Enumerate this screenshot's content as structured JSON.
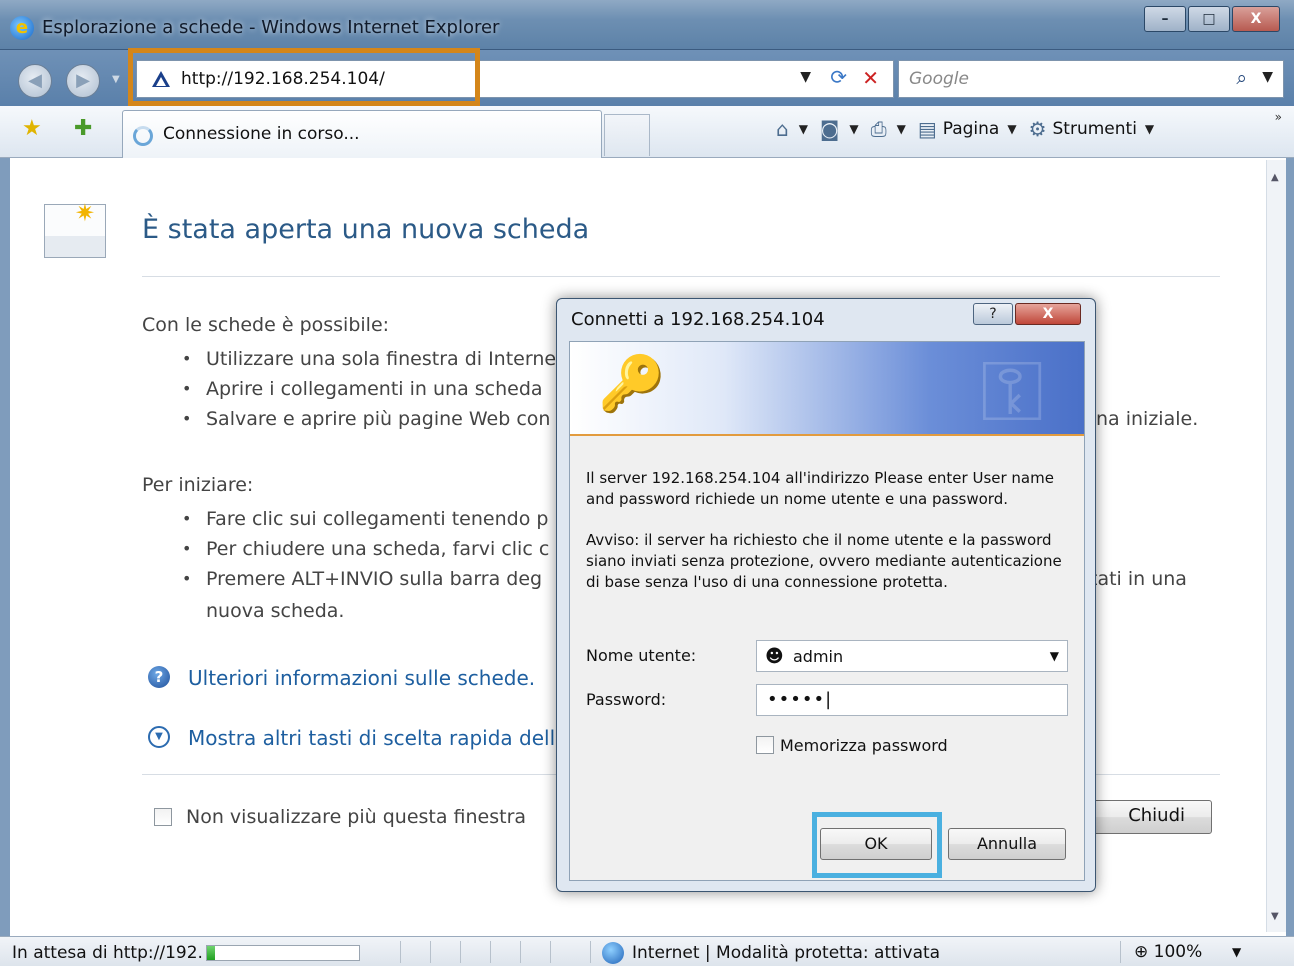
{
  "window": {
    "title": "Esplorazione a schede - Windows Internet Explorer",
    "controls": {
      "minimize": "–",
      "maximize": "□",
      "close": "X"
    }
  },
  "address_bar": {
    "url": "http://192.168.254.104/",
    "search_placeholder": "Google"
  },
  "tab": {
    "label": "Connessione in corso..."
  },
  "command_bar": {
    "page_label": "Pagina",
    "tools_label": "Strumenti"
  },
  "page": {
    "heading": "È stata aperta una nuova scheda",
    "intro1": "Con le schede è possibile:",
    "bullets1": [
      "Utilizzare una sola finestra di Interne",
      "Aprire i collegamenti in una scheda",
      "Salvare e aprire più pagine Web con"
    ],
    "bullet1_tail": "na iniziale.",
    "intro2": "Per iniziare:",
    "bullets2": [
      "Fare clic sui collegamenti tenendo p",
      "Per chiudere una scheda, farvi clic c",
      "Premere ALT+INVIO sulla barra deg"
    ],
    "bullet2_tail": "tati in una",
    "bullet2_cont": "nuova scheda.",
    "link_info": "Ulteriori informazioni sulle schede.",
    "link_shortcuts": "Mostra altri tasti di scelta rapida delle",
    "dont_show": "Non visualizzare più questa finestra",
    "close_button": "Chiudi"
  },
  "dialog": {
    "title": "Connetti a 192.168.254.104",
    "help": "?",
    "close": "X",
    "message": "Il server 192.168.254.104 all'indirizzo Please enter User name and password richiede un nome utente e una password.",
    "warning": "Avviso: il server ha richiesto che il nome utente e la password siano inviati senza protezione, ovvero mediante autenticazione di base senza l'uso di una connessione protetta.",
    "username_label": "Nome utente:",
    "username_value": "admin",
    "password_label": "Password:",
    "password_value": "•••••|",
    "remember_label": "Memorizza password",
    "ok_label": "OK",
    "cancel_label": "Annulla"
  },
  "status_bar": {
    "loading_text": "In attesa di http://192.",
    "progress": 0.05,
    "zone_text": "Internet | Modalità protetta: attivata",
    "zoom_text": "100%"
  }
}
